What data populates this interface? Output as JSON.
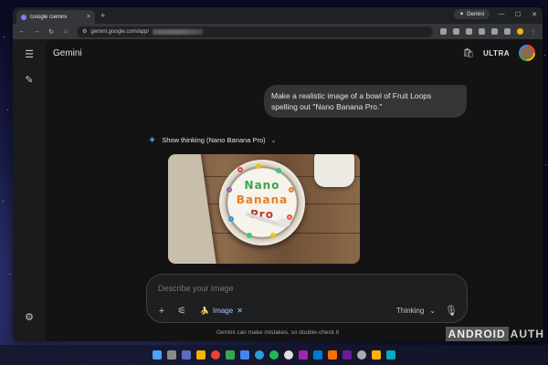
{
  "browser": {
    "tab_title": "Google Gemini",
    "tab_close": "×",
    "new_tab": "+",
    "side_pill": "Gemini",
    "url": "gemini.google.com/app/",
    "win_min": "—",
    "win_max": "☐",
    "win_close": "✕"
  },
  "app": {
    "brand": "Gemini",
    "plan_badge": "ULTRA",
    "user_prompt": "Make a realistic image of a bowl of Fruit Loops spelling out \"Nano Banana Pro.\"",
    "thinking_label": "Show thinking (Nano Banana Pro)",
    "image_text": [
      "Nano",
      "Banana",
      "Pro"
    ],
    "composer": {
      "placeholder": "Describe your image",
      "chip_label": "Image",
      "chip_emoji": "🍌",
      "mode_label": "Thinking"
    },
    "disclaimer": "Gemini can make mistakes, so double-check it"
  },
  "icons": {
    "menu": "☰",
    "new_chat": "✎",
    "settings": "⚙",
    "spark": "✦",
    "chevron": "⌄",
    "bag": "🛍",
    "plus": "+",
    "tools": "⚟",
    "mic": "🎙",
    "close": "✕"
  },
  "watermark": {
    "box": "ANDROID",
    "text": "AUTH"
  },
  "colors": {
    "accent": "#4b90ff",
    "chip": "#a8c7fa"
  }
}
